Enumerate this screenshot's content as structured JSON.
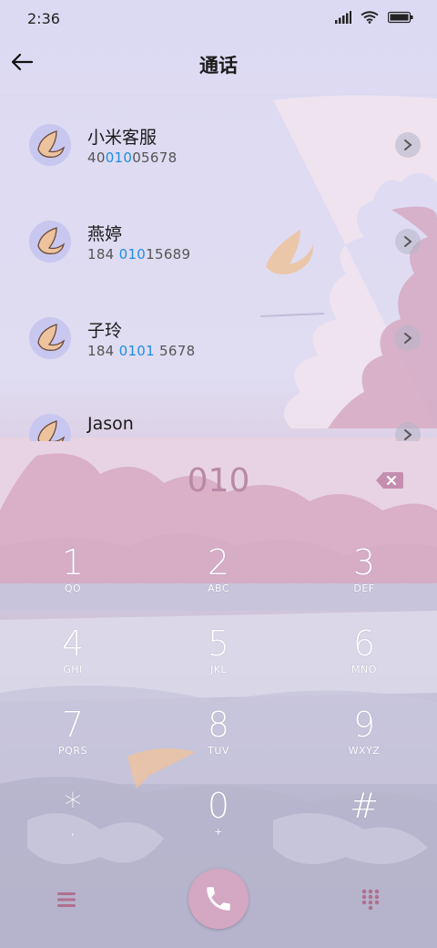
{
  "status_bar": {
    "time": "2:36"
  },
  "header": {
    "title": "通话"
  },
  "contacts": [
    {
      "name": "小米客服",
      "number_pre": "40",
      "number_hl": "010",
      "number_post": "05678"
    },
    {
      "name": "燕婷",
      "number_pre": "184 ",
      "number_hl": "010",
      "number_post": "15689"
    },
    {
      "name": "子玲",
      "number_pre": "184 ",
      "number_hl": "0101",
      "number_post": " 5678"
    },
    {
      "name": "Jason",
      "number_pre": "",
      "number_hl": "",
      "number_post": ""
    }
  ],
  "dial_input": {
    "value": "010"
  },
  "keypad": [
    {
      "digit": "1",
      "letters": "QO"
    },
    {
      "digit": "2",
      "letters": "ABC"
    },
    {
      "digit": "3",
      "letters": "DEF"
    },
    {
      "digit": "4",
      "letters": "GHI"
    },
    {
      "digit": "5",
      "letters": "JKL"
    },
    {
      "digit": "6",
      "letters": "MNO"
    },
    {
      "digit": "7",
      "letters": "PQRS"
    },
    {
      "digit": "8",
      "letters": "TUV"
    },
    {
      "digit": "9",
      "letters": "WXYZ"
    },
    {
      "digit": "*",
      "letters": ","
    },
    {
      "digit": "0",
      "letters": "+"
    },
    {
      "digit": "#",
      "letters": ""
    }
  ],
  "colors": {
    "accent": "#d4a7c3",
    "highlight": "#1e8fe0",
    "dial_text": "#b98aa6"
  },
  "icons": {
    "back": "arrow-left-icon",
    "chevron": "chevron-right-icon",
    "backspace": "backspace-icon",
    "menu": "menu-icon",
    "call": "phone-icon",
    "dialpad": "dialpad-icon"
  }
}
